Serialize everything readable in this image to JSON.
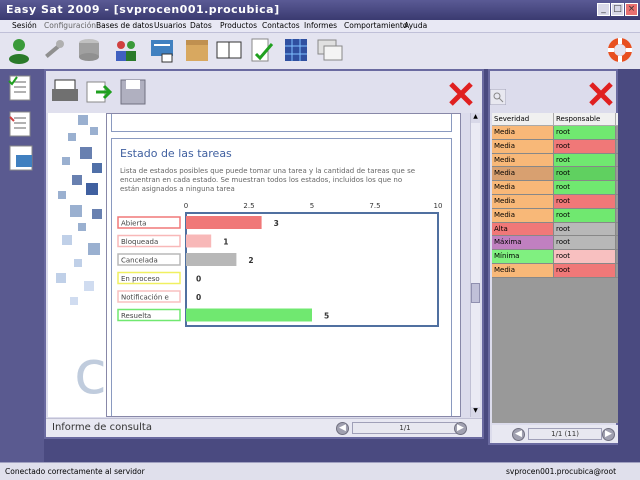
{
  "window": {
    "title": "Easy Sat 2009 - [svprocen001.procubica]"
  },
  "menu": [
    "Sesión",
    "Configuración",
    "Bases de datos",
    "Usuarios",
    "Datos",
    "Productos",
    "Contactos",
    "Informes",
    "Comportamiento",
    "Ayuda"
  ],
  "toolbar_icons": [
    "user-icon",
    "tools-icon",
    "database-icon",
    "users-icon",
    "card-icon",
    "box-icon",
    "book-icon",
    "checklist-icon",
    "network-icon",
    "windows-icon"
  ],
  "report": {
    "title": "Estado de las tareas",
    "description": "Lista de estados posibles que puede tomar una tarea y la cantidad de tareas que se encuentran en cada estado. Se muestran todos los estados, incluidos los que no están asignados a ninguna tarea",
    "footer_label": "Informe de consulta",
    "page": "1/1"
  },
  "chart_data": {
    "type": "bar",
    "orientation": "horizontal",
    "categories": [
      "Abierta",
      "Bloqueada",
      "Cancelada",
      "En proceso",
      "Notificación e",
      "Resuelta"
    ],
    "values": [
      3,
      1,
      2,
      0,
      0,
      5
    ],
    "colors": [
      "#f07878",
      "#f8b8b8",
      "#b8b8b8",
      "#f0f060",
      "#f8c0c0",
      "#70e870"
    ],
    "xticks": [
      "0",
      "2.5",
      "5",
      "7.5",
      "10"
    ],
    "xlim": [
      0,
      10
    ]
  },
  "grid": {
    "headers": [
      "Severidad",
      "Responsable"
    ],
    "rows": [
      {
        "severity": "Media",
        "owner": "root",
        "sev_color": "#f8b878",
        "own_color": "#70e870"
      },
      {
        "severity": "Media",
        "owner": "root",
        "sev_color": "#f8b878",
        "own_color": "#f07878"
      },
      {
        "severity": "Media",
        "owner": "root",
        "sev_color": "#f8b878",
        "own_color": "#70e870"
      },
      {
        "severity": "Media",
        "owner": "root",
        "sev_color": "#d8a070",
        "own_color": "#60d060"
      },
      {
        "severity": "Media",
        "owner": "root",
        "sev_color": "#f8b878",
        "own_color": "#70e870"
      },
      {
        "severity": "Media",
        "owner": "root",
        "sev_color": "#f8b878",
        "own_color": "#f07878"
      },
      {
        "severity": "Media",
        "owner": "root",
        "sev_color": "#f8b878",
        "own_color": "#70e870"
      },
      {
        "severity": "Alta",
        "owner": "root",
        "sev_color": "#f07878",
        "own_color": "#b8b8b8"
      },
      {
        "severity": "Máxima",
        "owner": "root",
        "sev_color": "#c080c0",
        "own_color": "#b8b8b8"
      },
      {
        "severity": "Mínima",
        "owner": "root",
        "sev_color": "#80f080",
        "own_color": "#f8c0c0"
      },
      {
        "severity": "Media",
        "owner": "root",
        "sev_color": "#f8b878",
        "own_color": "#f07878"
      }
    ],
    "page": "1/1 (11)"
  },
  "status": {
    "left": "Conectado correctamente al servidor",
    "right": "svprocen001.procubica@root"
  }
}
